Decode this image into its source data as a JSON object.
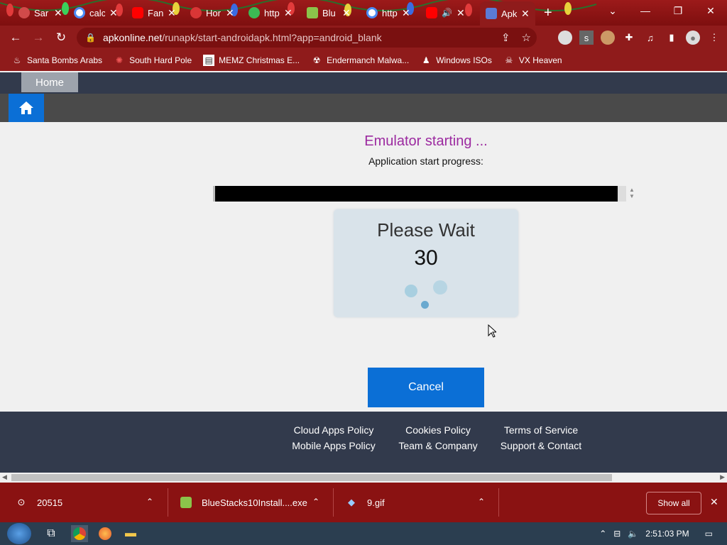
{
  "tabs": [
    {
      "title": "Sar",
      "color": "#d14a4a"
    },
    {
      "title": "calc",
      "color": "#4a8af4"
    },
    {
      "title": "Fan",
      "color": "#ff0000"
    },
    {
      "title": "Hor",
      "color": "#d93636"
    },
    {
      "title": "http",
      "color": "#3cba54"
    },
    {
      "title": "Blu",
      "color": "#8bc34a"
    },
    {
      "title": "http",
      "color": "#4a8af4"
    },
    {
      "title": "",
      "color": "#ff0000"
    },
    {
      "title": "Apk",
      "color": "#5b7bd6"
    }
  ],
  "address": {
    "domain": "apkonline.net",
    "path": "/runapk/start-androidapk.html?app=android_blank"
  },
  "bookmarks": [
    {
      "label": "Santa Bombs Arabs"
    },
    {
      "label": "South Hard Pole"
    },
    {
      "label": "MEMZ Christmas E..."
    },
    {
      "label": "Endermanch Malwa..."
    },
    {
      "label": "Windows ISOs"
    },
    {
      "label": "VX Heaven"
    }
  ],
  "site": {
    "home_tab": "Home",
    "title": "Emulator starting ...",
    "progress_label": "Application start progress:",
    "progress_fraction": 0.98,
    "wait_title": "Please Wait",
    "countdown": "30",
    "cancel_label": "Cancel",
    "title_color": "#9c2aa0",
    "accent": "#0b6fd6"
  },
  "footer": {
    "links": [
      "Cloud Apps Policy",
      "Cookies Policy",
      "Terms of Service",
      "Mobile Apps Policy",
      "Team & Company",
      "Support & Contact"
    ]
  },
  "downloads": {
    "items": [
      {
        "name": "20515"
      },
      {
        "name": "BlueStacks10Install....exe"
      },
      {
        "name": "9.gif"
      }
    ],
    "show_all": "Show all"
  },
  "taskbar": {
    "time": "2:51:03 PM"
  }
}
